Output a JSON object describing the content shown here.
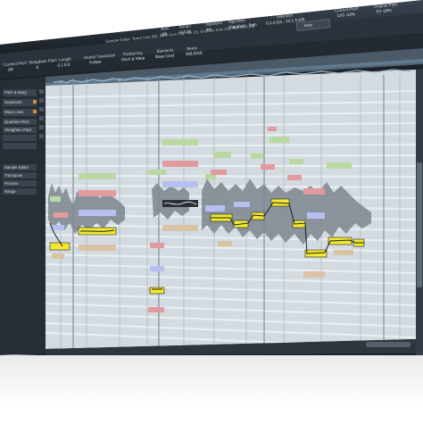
{
  "window": {
    "title": "Sample Editor: Tenor (vox (6)), Bass (vox (7)), vox (2), Soprano (vox (4)), Alto (vox (5))",
    "auto_button": "Auto"
  },
  "toolbar": {
    "row1": [
      {
        "label": "Auto",
        "value": "Off"
      },
      {
        "label": "Tempo",
        "value": "114.00"
      },
      {
        "label": "Signature",
        "value": "4/4"
      },
      {
        "label": "Algorithm",
        "value": "Standard - Solo"
      },
      {
        "label": "Selection",
        "value": "0.1.4.111 - 12.1.3.109"
      },
      {
        "label": "Current Pitch",
        "value": "C#3 -12%"
      },
      {
        "label": "Original Pitch",
        "value": "F3 -19%"
      }
    ],
    "row2": [
      {
        "label": "Correct Pitch",
        "value": "Off"
      },
      {
        "label": "Straighten Pitch",
        "value": "0"
      },
      {
        "label": "Length",
        "value": "0.1.0.0"
      },
      {
        "label": "Global Transpose",
        "value": "Follow"
      },
      {
        "label": "Positioning",
        "value": "Pitch & Warp"
      },
      {
        "label": "Elements",
        "value": "Bass (vox)"
      },
      {
        "label": "Beats",
        "value": "206.0218"
      }
    ]
  },
  "inspector": {
    "items": [
      {
        "label": "Pitch & Warp"
      },
      {
        "label": "Segments"
      },
      {
        "label": "Warp Lines"
      },
      {
        "label": "Quantize Pitch"
      },
      {
        "label": "Straighten Pitch"
      },
      {
        "label": "Sample Editor"
      },
      {
        "label": "Transpose"
      },
      {
        "label": "Process"
      },
      {
        "label": "Range"
      }
    ]
  },
  "colors": {
    "accent_yellow": "#f2e832",
    "note_green": "#b9d9a3",
    "note_red": "#e39a9f",
    "note_blue": "#b6bff0",
    "note_tan": "#d9c2a6",
    "background_grid": "#ced6dd",
    "chrome": "#1e2329"
  }
}
